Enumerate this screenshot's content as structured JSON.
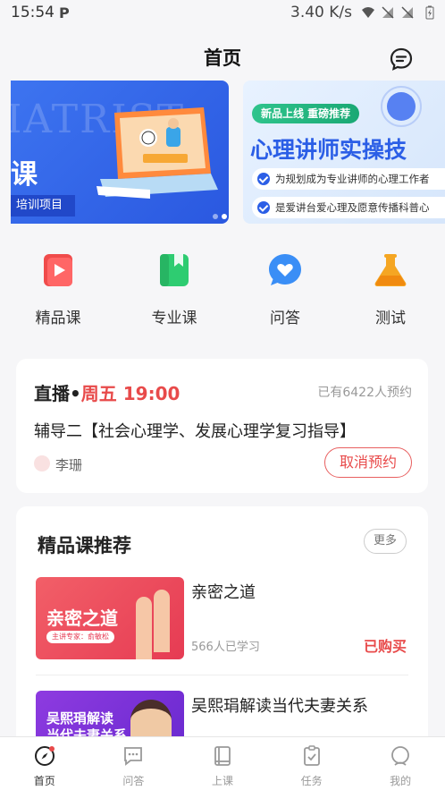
{
  "status_bar": {
    "time": "15:54",
    "network_speed": "3.40 K/s"
  },
  "header": {
    "title": "首页",
    "message_icon": "chat-bubble-icon"
  },
  "banners": [
    {
      "ghost_text": "IATRIST",
      "title_fragment": "课",
      "tag": "培训项目"
    },
    {
      "pill": "新品上线 重磅推荐",
      "title": "心理讲师实操技",
      "bullets": [
        "为规划成为专业讲师的心理工作者",
        "是爱讲台爱心理及愿意传播科普心"
      ]
    }
  ],
  "categories": [
    {
      "label": "精品课",
      "icon": "play-video-icon",
      "color": "#f04b4b"
    },
    {
      "label": "专业课",
      "icon": "book-icon",
      "color": "#2ecc71"
    },
    {
      "label": "问答",
      "icon": "heart-bubble-icon",
      "color": "#3a8ef6"
    },
    {
      "label": "测试",
      "icon": "flask-icon",
      "color": "#f5a623"
    }
  ],
  "live": {
    "label": "直播",
    "dot": "•",
    "when": "周五 19:00",
    "reserved": "已有6422人预约",
    "course": "辅导二【社会心理学、发展心理学复习指导】",
    "teacher": "李珊",
    "cancel_button": "取消预约"
  },
  "recommend": {
    "title": "精品课推荐",
    "more": "更多",
    "courses": [
      {
        "name": "亲密之道",
        "thumb_title": "亲密之道",
        "thumb_sub": "主讲专家：俞敏松",
        "learners": "566人已学习",
        "status": "已购买"
      },
      {
        "name": "吴熙琄解读当代夫妻关系",
        "thumb_title": "吴熙琄解读\n当代夫妻关系"
      }
    ]
  },
  "tabbar": {
    "items": [
      {
        "label": "首页",
        "icon": "compass-icon",
        "active": true
      },
      {
        "label": "问答",
        "icon": "chat-icon",
        "active": false
      },
      {
        "label": "上课",
        "icon": "book-open-icon",
        "active": false
      },
      {
        "label": "任务",
        "icon": "clipboard-check-icon",
        "active": false
      },
      {
        "label": "我的",
        "icon": "profile-icon",
        "active": false
      }
    ]
  },
  "colors": {
    "accent_red": "#e84a4a",
    "brand_blue": "#2b5ee6",
    "background": "#f6f6f8"
  }
}
